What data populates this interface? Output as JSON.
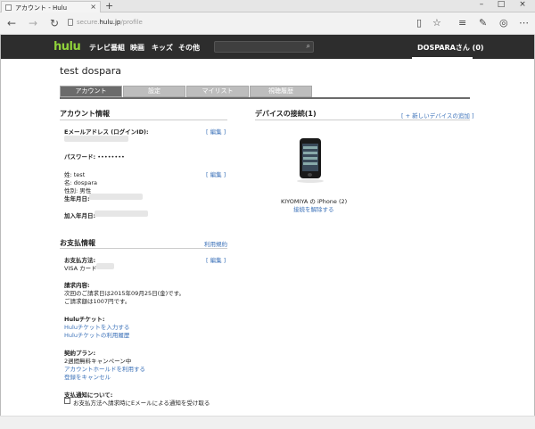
{
  "browser": {
    "tab_title": "アカウント - Hulu",
    "new_tab_glyph": "+",
    "address_prefix": "secure.",
    "address_host": "hulu.jp",
    "address_path": "/profile"
  },
  "header": {
    "logo": "hulu",
    "nav": [
      "テレビ番組",
      "映画",
      "キッズ",
      "その他"
    ],
    "user": "DOSPARAさん (0)"
  },
  "page": {
    "title": "test dospara",
    "tabs": [
      "アカウント",
      "設定",
      "マイリスト",
      "視聴履歴"
    ]
  },
  "account": {
    "heading": "アカウント情報",
    "email_label": "Eメールアドレス (ログインID):",
    "edit": "[ 編集 ]",
    "password_label": "パスワード:",
    "password_value": "••••••••",
    "last_name": "姓: test",
    "first_name": "名: dospara",
    "gender": "性別: 男性",
    "birthday": "生年月日:",
    "joined": "加入年月日:"
  },
  "payment": {
    "heading": "お支払情報",
    "terms_link": "利用規約",
    "method_label": "お支払方法:",
    "method_value": "VISA カード",
    "billing_label": "請求内容:",
    "billing_line1": "次回のご請求日は2015年09月25日(金)です。",
    "billing_line2": "ご請求額は1007円です。",
    "ticket_label": "Huluチケット:",
    "ticket_link1": "Huluチケットを入力する",
    "ticket_link2": "Huluチケットの利用履歴",
    "plan_label": "契約プラン:",
    "plan_value": "2週間無料キャンペーン中",
    "plan_link1": "アカウントホールドを利用する",
    "plan_link2": "登録をキャンセル",
    "notice_label": "支払通知について:",
    "notice_checkbox": "お支払方法へ請求時にEメールによる通知を受け取る"
  },
  "devices": {
    "heading": "デバイスの接続(1)",
    "add_link": "[ + 新しいデバイスの追加 ]",
    "device_name": "KIYOMIYA の iPhone (2)",
    "unlink": "接続を解除する"
  }
}
